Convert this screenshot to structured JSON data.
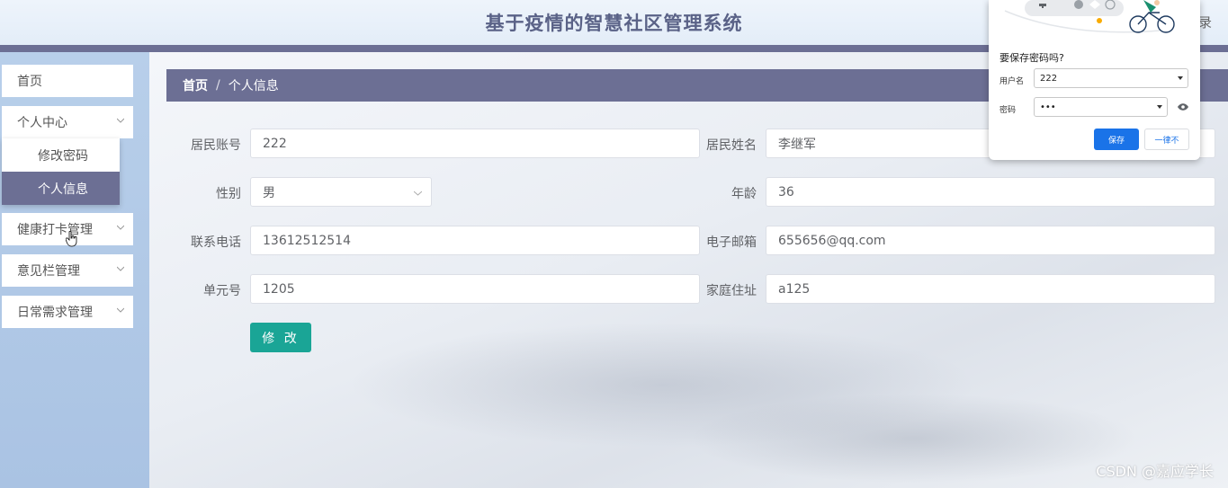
{
  "header": {
    "title": "基于疫情的智慧社区管理系统",
    "logout_partial": "录"
  },
  "sidebar": {
    "items": [
      {
        "label": "首页"
      },
      {
        "label": "个人中心"
      },
      {
        "label": "健康打卡管理"
      },
      {
        "label": "意见栏管理"
      },
      {
        "label": "日常需求管理"
      }
    ],
    "submenu": [
      {
        "label": "修改密码"
      },
      {
        "label": "个人信息"
      }
    ]
  },
  "breadcrumb": {
    "home": "首页",
    "separator": "/",
    "current": "个人信息"
  },
  "form": {
    "account": {
      "label": "居民账号",
      "value": "222"
    },
    "name": {
      "label": "居民姓名",
      "value": "李继军"
    },
    "gender": {
      "label": "性别",
      "value": "男"
    },
    "age": {
      "label": "年龄",
      "value": "36"
    },
    "phone": {
      "label": "联系电话",
      "value": "13612512514"
    },
    "email": {
      "label": "电子邮箱",
      "value": "655656@qq.com"
    },
    "unit": {
      "label": "单元号",
      "value": "1205"
    },
    "address": {
      "label": "家庭住址",
      "value": "a125"
    },
    "submit_label": "修 改"
  },
  "password_popup": {
    "title": "要保存密码吗?",
    "username_label": "用户名",
    "username_value": "222",
    "password_label": "密码",
    "password_value": "•••",
    "save_label": "保存",
    "never_label": "一律不"
  },
  "watermark": "CSDN @嘉应学长",
  "colors": {
    "accent": "#6c6f94",
    "button": "#1aa596",
    "popup_button": "#1a73e8"
  }
}
